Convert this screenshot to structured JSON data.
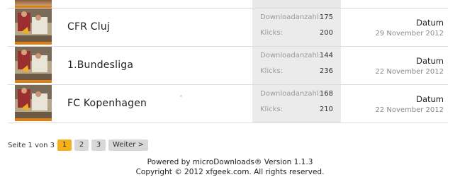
{
  "rows": [
    {
      "title": "CFR Cluj",
      "downloads_label": "Downloadanzahl:",
      "downloads": "175",
      "clicks_label": "Klicks:",
      "clicks": "200",
      "date_label": "Datum",
      "date": "29 November 2012",
      "icon": "football-thumbnail-icon"
    },
    {
      "title": "1.Bundesliga",
      "downloads_label": "Downloadanzahl:",
      "downloads": "144",
      "clicks_label": "Klicks:",
      "clicks": "236",
      "date_label": "Datum",
      "date": "22 November 2012",
      "icon": "football-thumbnail-icon"
    },
    {
      "title": "FC Kopenhagen",
      "downloads_label": "Downloadanzahl:",
      "downloads": "168",
      "clicks_label": "Klicks:",
      "clicks": "210",
      "date_label": "Datum",
      "date": "22 November 2012",
      "icon": "football-thumbnail-icon"
    }
  ],
  "pagination": {
    "info": "Seite 1 von 3",
    "pages": [
      "1",
      "2",
      "3"
    ],
    "current": "1",
    "next": "Weiter >"
  },
  "footer": {
    "powered": "Powered by microDownloads® Version 1.1.3",
    "copyright": "Copyright © 2012 xfgeek.com. All rights reserved."
  },
  "colors": {
    "accent": "#f6b11a",
    "thumb_stripe": "#e07f12"
  }
}
